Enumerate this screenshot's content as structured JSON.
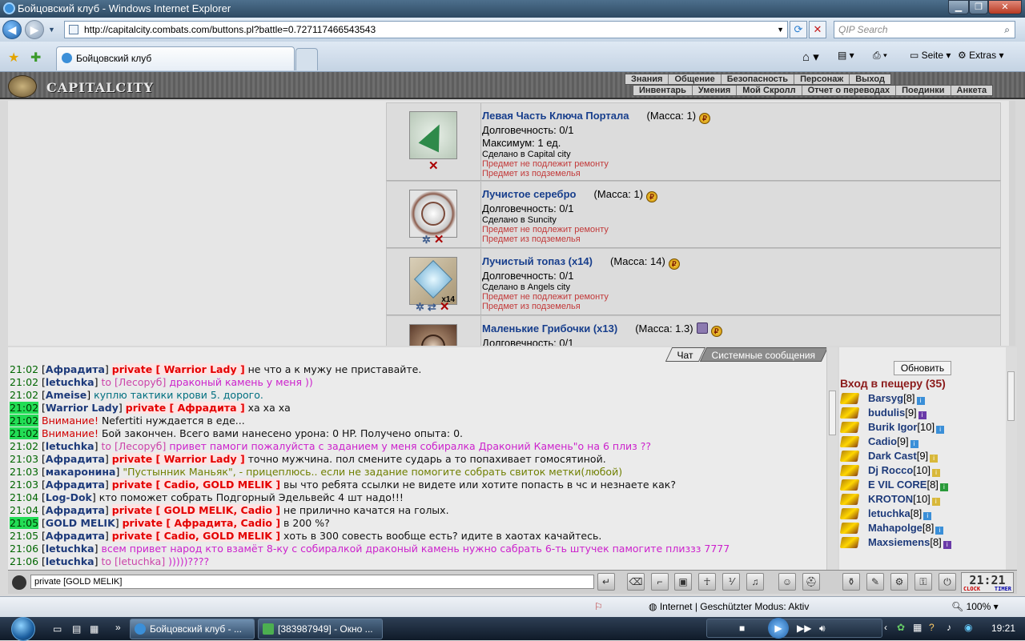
{
  "window": {
    "title": "Бойцовский клуб - Windows Internet Explorer",
    "url": "http://capitalcity.combats.com/buttons.pl?battle=0.727117466543543",
    "search_placeholder": "QIP Search",
    "tab_title": "Бойцовский клуб",
    "commands": {
      "page": "Seite",
      "extras": "Extras"
    }
  },
  "game": {
    "city": "CAPITALCITY",
    "menu_top": [
      "Знания",
      "Общение",
      "Безопасность",
      "Персонаж",
      "Выход"
    ],
    "menu_bottom": [
      "Инвентарь",
      "Умения",
      "Мой Скролл",
      "Отчет о переводах",
      "Поединки",
      "Анкета"
    ]
  },
  "inventory": [
    {
      "name": "Левая Часть Ключа Портала",
      "mass": "(Масса: 1)",
      "lines": [
        "Долговечность: 0/1",
        "Максимум: 1 ед."
      ],
      "made": "Сделано в Capital city",
      "notes": [
        "Предмет не подлежит ремонту",
        "Предмет из подземелья"
      ]
    },
    {
      "name": "Лучистое серебро",
      "mass": "(Масса: 1)",
      "lines": [
        "Долговечность: 0/1"
      ],
      "made": "Сделано в Suncity",
      "notes": [
        "Предмет не подлежит ремонту",
        "Предмет из подземелья"
      ]
    },
    {
      "name": "Лучистый топаз (x14)",
      "mass": "(Масса: 14)",
      "lines": [
        "Долговечность: 0/1"
      ],
      "made": "Сделано в Angels city",
      "notes": [
        "Предмет не подлежит ремонту",
        "Предмет из подземелья"
      ],
      "badge": "x14"
    },
    {
      "name": "Маленькие Грибочки (x13)",
      "mass": "(Масса: 1.3)",
      "lines": [
        "Долговечность: 0/1"
      ],
      "made": "",
      "notes": []
    }
  ],
  "chat": {
    "tabs": [
      "Чат",
      "Системные сообщения"
    ],
    "lines": [
      {
        "t": "21:02",
        "nick": "Афрадита",
        "priv": "private [ Warrior Lady ]",
        "msg": " не что а к мужу не приставайте.",
        "cls": "msg-priv"
      },
      {
        "t": "21:02",
        "nick": "letuchka",
        "to": "to [Лесоруб]",
        "msg": " драконый камень у меня ))",
        "cls": "msg-to"
      },
      {
        "t": "21:02",
        "nick": "Ameise",
        "msg": " куплю тактики крови 5. дорого.",
        "cls": "msg-gen"
      },
      {
        "t": "21:02",
        "hl": true,
        "nick": "Warrior Lady",
        "priv": "private [ Афрадита ]",
        "msg": " ха ха ха",
        "cls": "msg-priv"
      },
      {
        "t": "21:02",
        "hl": true,
        "warn": "Внимание!",
        "msg": " Nefertiti нуждается в еде...",
        "cls": "msg-plain"
      },
      {
        "t": "21:02",
        "hl": true,
        "warn": "Внимание!",
        "msg": " Бой закончен. Всего вами нанесено урона: 0 HP. Получено опыта: 0.",
        "cls": "msg-plain"
      },
      {
        "t": "21:02",
        "nick": "letuchka",
        "to": "to [Лесоруб]",
        "msg": " привет памоги пожалуйста с заданием у меня собиралка Драконий Камень\"о на 6 плиз ??",
        "cls": "msg-to"
      },
      {
        "t": "21:03",
        "nick": "Афрадита",
        "priv": "private [ Warrior Lady ]",
        "msg": " точно мужчина. пол смените сударь а то попахивает гомосятиной.",
        "cls": "msg-priv"
      },
      {
        "t": "21:03",
        "nick": "макаронина",
        "msg": " \"Пустынник Маньяк\", - прицеплюсь.. если не задание помогите собрать свиток метки(любой)",
        "cls": "msg-gen2"
      },
      {
        "t": "21:03",
        "nick": "Афрадита",
        "priv": "private [ Cadio, GOLD MELIK ]",
        "msg": " вы что ребята ссылки не видете или хотите попасть в чс и незнаете как?",
        "cls": "msg-priv"
      },
      {
        "t": "21:04",
        "nick": "Log-Dok",
        "msg": " кто поможет собрать Подгорный Эдельвейс 4 шт надо!!!",
        "cls": "msg-plain"
      },
      {
        "t": "21:04",
        "nick": "Афрадита",
        "priv": "private [ GOLD MELIK, Cadio ]",
        "msg": " не прилично качатся на голых.",
        "cls": "msg-priv"
      },
      {
        "t": "21:05",
        "hl": true,
        "nick": "GOLD MELIK",
        "priv": "private [ Афрадита, Cadio ]",
        "msg": " в 200 %?",
        "cls": "msg-priv"
      },
      {
        "t": "21:05",
        "nick": "Афрадита",
        "priv": "private [ Cadio, GOLD MELIK ]",
        "msg": " хоть в 300 совесть вообще есть? идите в хаотах качайтесь.",
        "cls": "msg-priv"
      },
      {
        "t": "21:06",
        "nick": "letuchka",
        "msg": " всем привет народ кто взамёт 8-ку с собиралкой драконый камень нужно сабрать 6-ть штучек памогите плиззз 7777",
        "cls": "msg-to"
      },
      {
        "t": "21:06",
        "nick": "letuchka",
        "to": "to [letuchka]",
        "msg": " )))))????",
        "cls": "msg-to"
      }
    ],
    "input_value": "private [GOLD MELIK]"
  },
  "users": {
    "refresh_label": "Обновить",
    "location": "Вход в пещеру (35)",
    "list": [
      {
        "name": "Barsyg",
        "lvl": "[8]"
      },
      {
        "name": "budulis",
        "lvl": "[9]"
      },
      {
        "name": "Burik Igor",
        "lvl": "[10]"
      },
      {
        "name": "Cadio",
        "lvl": "[9]"
      },
      {
        "name": "Dark Cast",
        "lvl": "[9]"
      },
      {
        "name": "Dj Rocco",
        "lvl": "[10]"
      },
      {
        "name": "E VIL CORE",
        "lvl": "[8]"
      },
      {
        "name": "KROTON",
        "lvl": "[10]"
      },
      {
        "name": "letuchka",
        "lvl": "[8]"
      },
      {
        "name": "Mahapolge",
        "lvl": "[8]"
      },
      {
        "name": "Maxsiemens",
        "lvl": "[8]"
      }
    ]
  },
  "clock": {
    "display": "21:21",
    "label_clock": "CLOCK",
    "label_timer": "TIMER"
  },
  "statusbar": {
    "zone": "Internet | Geschützter Modus: Aktiv",
    "zoom": "100%"
  },
  "taskbar": {
    "tasks": [
      "Бойцовский клуб - ...",
      "[383987949] - Окно ..."
    ],
    "time": "19:21"
  },
  "colors": {
    "nick": "#1d3a7a",
    "private": "#e40000",
    "time": "#006600",
    "time_highlight": "#22dd55",
    "location": "#8b1a1a"
  }
}
